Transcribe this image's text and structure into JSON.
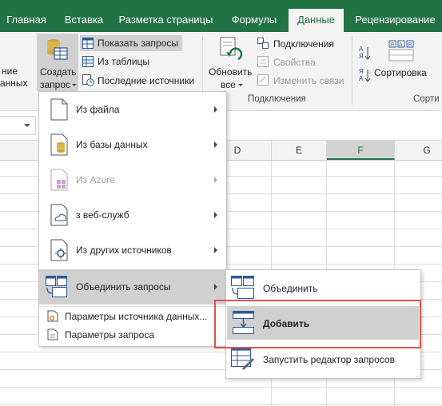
{
  "tabs": [
    {
      "label": "Главная",
      "active": false
    },
    {
      "label": "Вставка",
      "active": false
    },
    {
      "label": "Разметка страницы",
      "active": false
    },
    {
      "label": "Формулы",
      "active": false
    },
    {
      "label": "Данные",
      "active": true
    },
    {
      "label": "Рецензирование",
      "active": false
    }
  ],
  "ribbon": {
    "left_cut_1": "ние",
    "left_cut_2": "анных",
    "create_query_1": "Создать",
    "create_query_2": "запрос",
    "show_queries": "Показать запросы",
    "from_table": "Из таблицы",
    "recent_sources": "Последние источники",
    "refresh_all_1": "Обновить",
    "refresh_all_2": "все",
    "connections": "Подключения",
    "properties": "Свойства",
    "edit_links": "Изменить связи",
    "connections_group": "Подключения",
    "sort": "Сортировка",
    "sort_group": "Сорти"
  },
  "columns": [
    "D",
    "E",
    "F",
    "G"
  ],
  "menu1": {
    "items": [
      {
        "label": "Из файла",
        "arrow": true
      },
      {
        "label": "Из базы данных",
        "arrow": true
      },
      {
        "label": "Из Azure",
        "arrow": true,
        "disabled": true
      },
      {
        "label": "з веб-служб",
        "arrow": true
      },
      {
        "label": "Из других источников",
        "arrow": true
      },
      {
        "label": "Объединить запросы",
        "arrow": true,
        "highlighted": true
      }
    ],
    "footer": [
      {
        "label": "Параметры источника данных..."
      },
      {
        "label": "Параметры запроса"
      }
    ]
  },
  "menu2": {
    "items": [
      {
        "label": "Объединить"
      },
      {
        "label": "Добавить",
        "highlighted": true
      },
      {
        "label": "Запустить редактор запросов"
      }
    ]
  },
  "colors": {
    "brand": "#217346",
    "highlight": "#d0d0d0",
    "callout": "#d9534f"
  }
}
